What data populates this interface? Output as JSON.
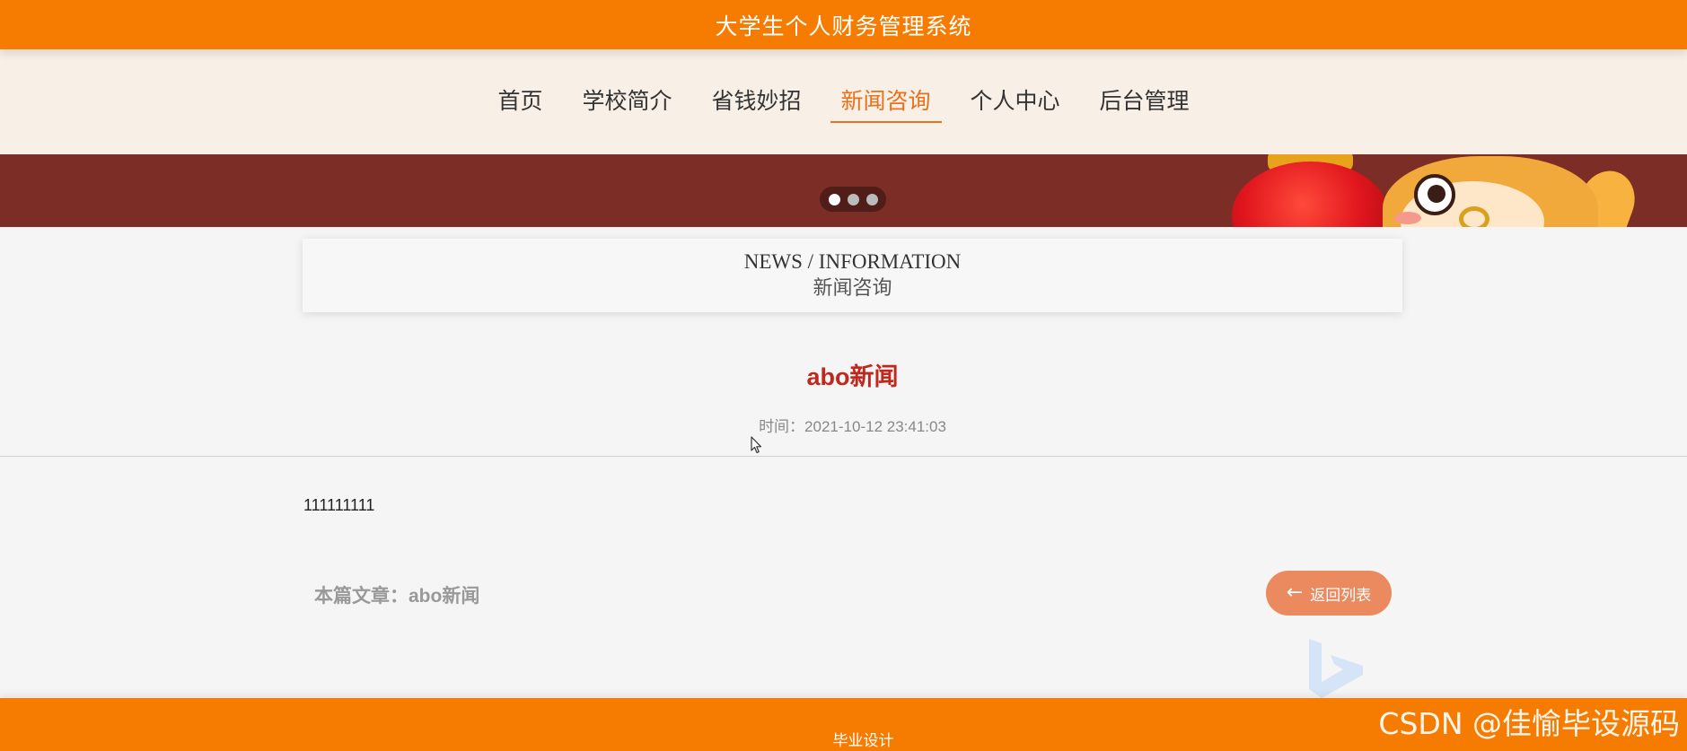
{
  "header": {
    "title": "大学生个人财务管理系统"
  },
  "nav": {
    "items": [
      {
        "label": "首页",
        "active": false
      },
      {
        "label": "学校简介",
        "active": false
      },
      {
        "label": "省钱妙招",
        "active": false
      },
      {
        "label": "新闻咨询",
        "active": true
      },
      {
        "label": "个人中心",
        "active": false
      },
      {
        "label": "后台管理",
        "active": false
      }
    ]
  },
  "banner": {
    "slide_count": 3,
    "active_slide": 1
  },
  "section": {
    "title_en": "NEWS / INFORMATION",
    "title_cn": "新闻咨询"
  },
  "article": {
    "title": "abo新闻",
    "meta": "时间：2021-10-12 23:41:03",
    "body": "111111111",
    "this_article": "本篇文章：abo新闻",
    "back_label": "返回列表"
  },
  "footer": {
    "text": "毕业设计"
  },
  "watermark": "CSDN @佳愉毕设源码",
  "colors": {
    "primary": "#f57c00",
    "nav_bg": "#f8efe6",
    "banner_bg": "#7b2d26",
    "title_red": "#c0281d",
    "button": "#ec8a5f"
  },
  "icons": {
    "back": "arrow-left-icon",
    "cursor": "mouse-cursor-icon",
    "corner": "bing-logo-icon"
  }
}
